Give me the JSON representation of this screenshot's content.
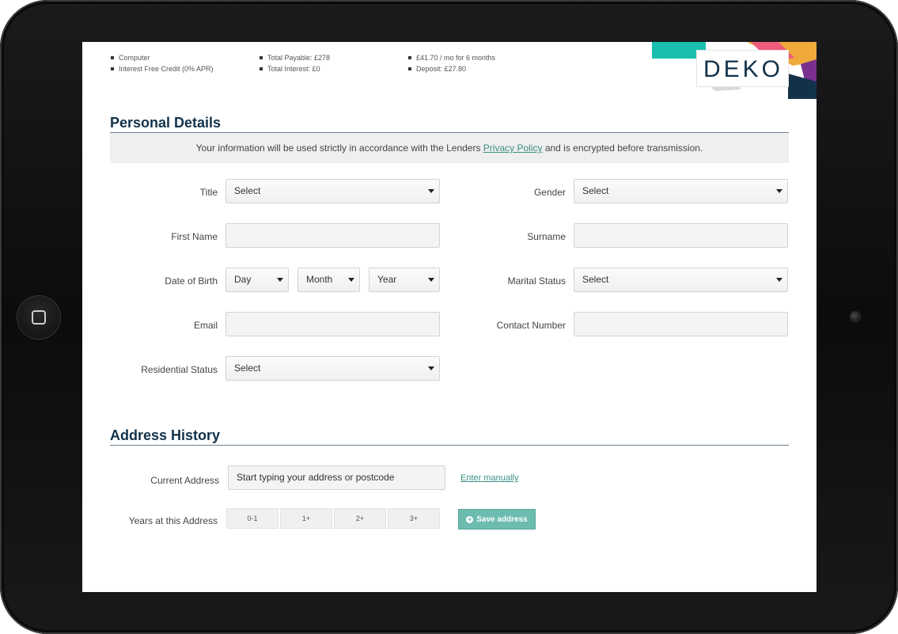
{
  "summary": {
    "col1": [
      "Computer",
      "Interest Free Credit (0% APR)"
    ],
    "col2": [
      "Total Payable: £278",
      "Total Interest: £0"
    ],
    "col3": [
      "£41.70 / mo for 6 months",
      "Deposit: £27.80"
    ]
  },
  "brand": {
    "logo_text": "DEKO",
    "colors": {
      "teal": "#1bbfae",
      "pink": "#ef5b7b",
      "orange": "#f0a93b",
      "purple": "#7a2f8f",
      "navy": "#12324a"
    }
  },
  "personal": {
    "title": "Personal Details",
    "notice_before": "Your information will be used strictly in accordance with the Lenders ",
    "notice_link": "Privacy Policy",
    "notice_after": " and is encrypted before transmission.",
    "title_label": "Title",
    "title_value": "Select",
    "gender_label": "Gender",
    "gender_value": "Select",
    "first_name_label": "First Name",
    "first_name_value": "",
    "surname_label": "Surname",
    "surname_value": "",
    "dob_label": "Date of Birth",
    "dob_day": "Day",
    "dob_month": "Month",
    "dob_year": "Year",
    "marital_label": "Marital Status",
    "marital_value": "Select",
    "email_label": "Email",
    "email_value": "",
    "contact_label": "Contact Number",
    "contact_value": "",
    "residential_label": "Residential Status",
    "residential_value": "Select"
  },
  "address": {
    "title": "Address History",
    "current_label": "Current Address",
    "current_placeholder": "Start typing your address or postcode",
    "enter_manually": "Enter manually",
    "years_label": "Years at this Address",
    "years_options": [
      "0-1",
      "1+",
      "2+",
      "3+"
    ],
    "save_label": "Save address"
  }
}
